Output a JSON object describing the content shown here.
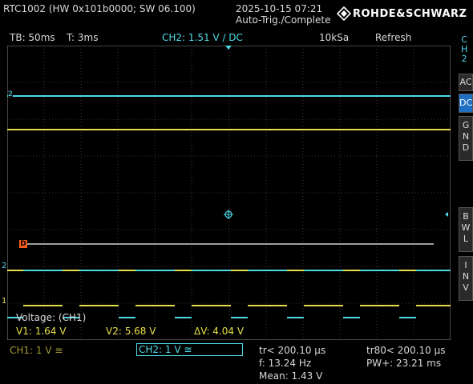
{
  "header": {
    "device": "RTC1002 (HW 0x101b0000; SW 06.100)",
    "datetime": "2025-10-15 07:21",
    "status": "Auto-Trig./Complete",
    "brand": "ROHDE&SCHWARZ"
  },
  "settings": {
    "timebase": "TB: 50ms",
    "trigger_time": "T: 3ms",
    "trigger_setting": "CH2: 1.51 V ∕ DC",
    "sample_rate": "10kSa",
    "mode": "Refresh"
  },
  "side_panel": {
    "channel_label": [
      "C",
      "H",
      "2"
    ],
    "ac": "AC",
    "dc": "DC",
    "gnd": [
      "G",
      "N",
      "D"
    ],
    "bwl": [
      "B",
      "W",
      "L"
    ],
    "inv": [
      "I",
      "N",
      "V"
    ]
  },
  "markers": {
    "ch2_marker": "2",
    "ch1_marker": "1",
    "trigger_marker": "2",
    "level_marker": "D"
  },
  "cursor": {
    "title": "Voltage: (CH1)",
    "v1": "V1: 1.64 V",
    "v2": "V2: 5.68 V",
    "dv": "ΔV: 4.04 V"
  },
  "bottom": {
    "ch1": "CH1: 1 V ≅",
    "ch2": "CH2: 1 V ≅",
    "tr": "tr< 200.10 µs",
    "freq": "f: 13.24 Hz",
    "mean": "Mean: 1.43 V",
    "tr80": "tr80< 200.10 µs",
    "pw": "PW+: 23.21 ms"
  },
  "colors": {
    "ch1": "#e8e04a",
    "ch2": "#4fd9e6",
    "grid": "#3a3a3a",
    "active_button": "#1f6fc2",
    "cursor_line": "#cfcfcf",
    "trigger_marker": "#ff5a1e"
  },
  "icons": {
    "logo": "rohde-schwarz-diamond-icon",
    "trigger_position": "trigger-position-arrow-icon",
    "center": "center-crosshair-icon"
  }
}
